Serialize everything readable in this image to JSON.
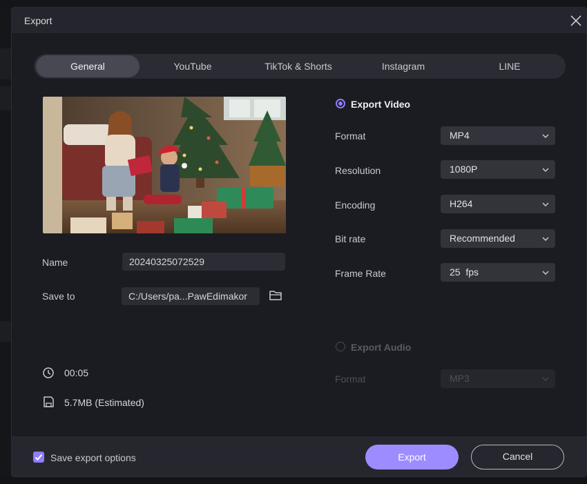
{
  "dialog": {
    "title": "Export"
  },
  "tabs": [
    {
      "label": "General",
      "active": true
    },
    {
      "label": "YouTube",
      "active": false
    },
    {
      "label": "TikTok & Shorts",
      "active": false
    },
    {
      "label": "Instagram",
      "active": false
    },
    {
      "label": "LINE",
      "active": false
    }
  ],
  "form": {
    "name_label": "Name",
    "name_value": "20240325072529",
    "save_to_label": "Save to",
    "save_to_value": "C:/Users/pa...PawEdimakor"
  },
  "info": {
    "duration": "00:05",
    "size": "5.7MB (Estimated)"
  },
  "export_video": {
    "title": "Export Video",
    "selected": true,
    "settings": [
      {
        "label": "Format",
        "value": "MP4"
      },
      {
        "label": "Resolution",
        "value": "1080P"
      },
      {
        "label": "Encoding",
        "value": "H264"
      },
      {
        "label": "Bit rate",
        "value": "Recommended"
      },
      {
        "label": "Frame Rate",
        "value": "25  fps"
      }
    ]
  },
  "export_audio": {
    "title": "Export Audio",
    "selected": false,
    "format_label": "Format",
    "format_value": "MP3"
  },
  "footer": {
    "save_options_label": "Save export options",
    "save_options_checked": true,
    "export_label": "Export",
    "cancel_label": "Cancel"
  },
  "colors": {
    "accent": "#9c8cff",
    "panel": "#1b1c22",
    "field": "#2c2d34"
  },
  "icons": [
    "close-icon",
    "folder-icon",
    "clock-icon",
    "disk-icon",
    "chevron-down-icon",
    "checkmark-icon"
  ]
}
